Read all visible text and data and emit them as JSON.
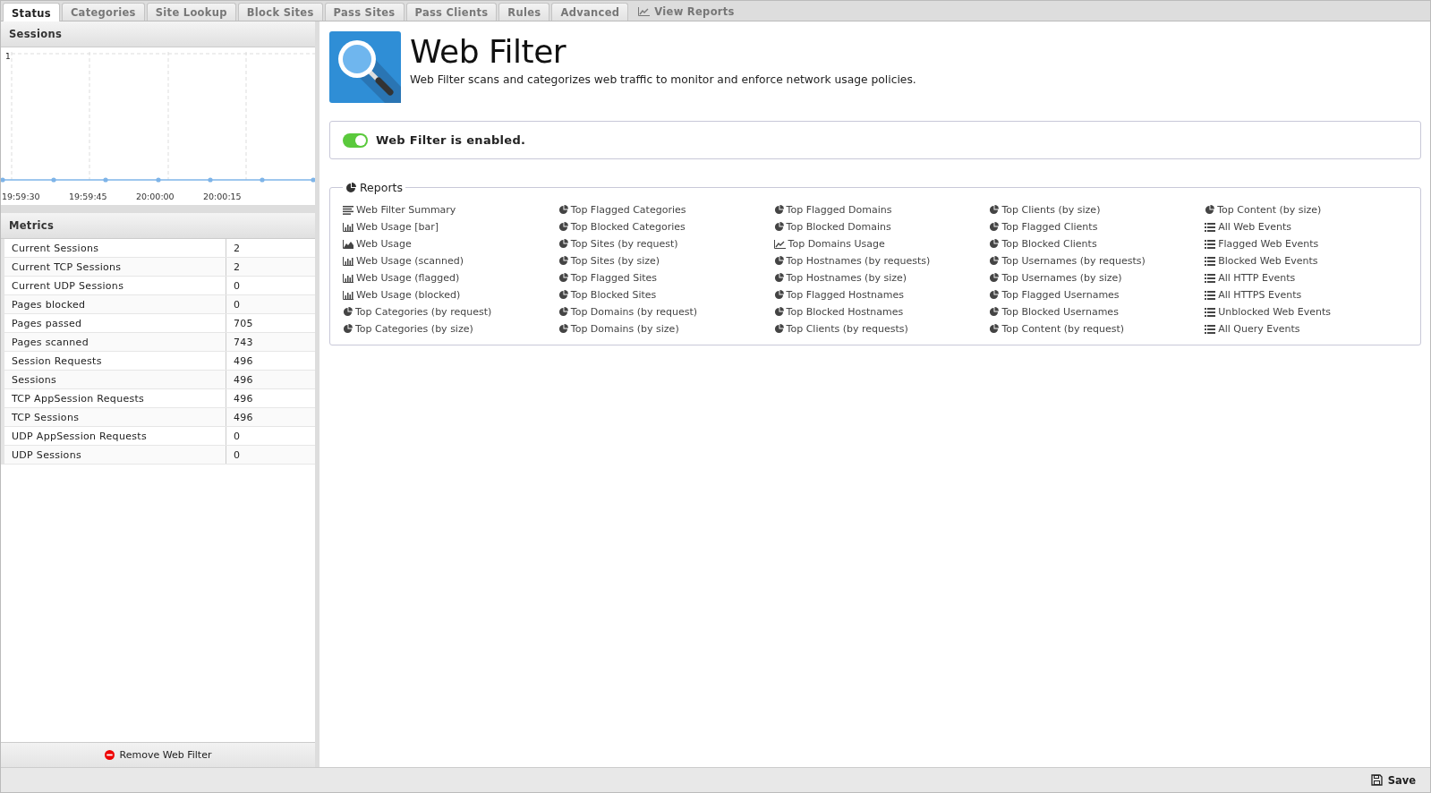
{
  "tabs": [
    {
      "label": "Status",
      "selected": true,
      "kind": "tab"
    },
    {
      "label": "Categories",
      "selected": false,
      "kind": "tab"
    },
    {
      "label": "Site Lookup",
      "selected": false,
      "kind": "tab"
    },
    {
      "label": "Block Sites",
      "selected": false,
      "kind": "tab"
    },
    {
      "label": "Pass Sites",
      "selected": false,
      "kind": "tab"
    },
    {
      "label": "Pass Clients",
      "selected": false,
      "kind": "tab"
    },
    {
      "label": "Rules",
      "selected": false,
      "kind": "tab"
    },
    {
      "label": "Advanced",
      "selected": false,
      "kind": "tab"
    },
    {
      "label": "View Reports",
      "selected": false,
      "kind": "link"
    }
  ],
  "sessions": {
    "title": "Sessions",
    "y_label": "1",
    "x_labels": [
      "19:59:30",
      "19:59:45",
      "20:00:00",
      "20:00:15"
    ]
  },
  "metrics": {
    "title": "Metrics",
    "rows": [
      {
        "name": "Current Sessions",
        "value": "2"
      },
      {
        "name": "Current TCP Sessions",
        "value": "2"
      },
      {
        "name": "Current UDP Sessions",
        "value": "0"
      },
      {
        "name": "Pages blocked",
        "value": "0"
      },
      {
        "name": "Pages passed",
        "value": "705"
      },
      {
        "name": "Pages scanned",
        "value": "743"
      },
      {
        "name": "Session Requests",
        "value": "496"
      },
      {
        "name": "Sessions",
        "value": "496"
      },
      {
        "name": "TCP AppSession Requests",
        "value": "496"
      },
      {
        "name": "TCP Sessions",
        "value": "496"
      },
      {
        "name": "UDP AppSession Requests",
        "value": "0"
      },
      {
        "name": "UDP Sessions",
        "value": "0"
      }
    ]
  },
  "remove_button": "Remove Web Filter",
  "app": {
    "title": "Web Filter",
    "description": "Web Filter scans and categorizes web traffic to monitor and enforce network usage policies."
  },
  "status": {
    "text": "Web Filter is enabled.",
    "on": true
  },
  "reports": {
    "title": "Reports",
    "columns": [
      [
        {
          "label": "Web Filter Summary",
          "kind": "text"
        },
        {
          "label": "Web Usage [bar]",
          "kind": "bar"
        },
        {
          "label": "Web Usage",
          "kind": "area"
        },
        {
          "label": "Web Usage (scanned)",
          "kind": "bar"
        },
        {
          "label": "Web Usage (flagged)",
          "kind": "bar"
        },
        {
          "label": "Web Usage (blocked)",
          "kind": "bar"
        },
        {
          "label": "Top Categories (by request)",
          "kind": "pie"
        },
        {
          "label": "Top Categories (by size)",
          "kind": "pie"
        }
      ],
      [
        {
          "label": "Top Flagged Categories",
          "kind": "pie"
        },
        {
          "label": "Top Blocked Categories",
          "kind": "pie"
        },
        {
          "label": "Top Sites (by request)",
          "kind": "pie"
        },
        {
          "label": "Top Sites (by size)",
          "kind": "pie"
        },
        {
          "label": "Top Flagged Sites",
          "kind": "pie"
        },
        {
          "label": "Top Blocked Sites",
          "kind": "pie"
        },
        {
          "label": "Top Domains (by request)",
          "kind": "pie"
        },
        {
          "label": "Top Domains (by size)",
          "kind": "pie"
        }
      ],
      [
        {
          "label": "Top Flagged Domains",
          "kind": "pie"
        },
        {
          "label": "Top Blocked Domains",
          "kind": "pie"
        },
        {
          "label": "Top Domains Usage",
          "kind": "line"
        },
        {
          "label": "Top Hostnames (by requests)",
          "kind": "pie"
        },
        {
          "label": "Top Hostnames (by size)",
          "kind": "pie"
        },
        {
          "label": "Top Flagged Hostnames",
          "kind": "pie"
        },
        {
          "label": "Top Blocked Hostnames",
          "kind": "pie"
        },
        {
          "label": "Top Clients (by requests)",
          "kind": "pie"
        }
      ],
      [
        {
          "label": "Top Clients (by size)",
          "kind": "pie"
        },
        {
          "label": "Top Flagged Clients",
          "kind": "pie"
        },
        {
          "label": "Top Blocked Clients",
          "kind": "pie"
        },
        {
          "label": "Top Usernames (by requests)",
          "kind": "pie"
        },
        {
          "label": "Top Usernames (by size)",
          "kind": "pie"
        },
        {
          "label": "Top Flagged Usernames",
          "kind": "pie"
        },
        {
          "label": "Top Blocked Usernames",
          "kind": "pie"
        },
        {
          "label": "Top Content (by request)",
          "kind": "pie"
        }
      ],
      [
        {
          "label": "Top Content (by size)",
          "kind": "pie"
        },
        {
          "label": "All Web Events",
          "kind": "events"
        },
        {
          "label": "Flagged Web Events",
          "kind": "events"
        },
        {
          "label": "Blocked Web Events",
          "kind": "events"
        },
        {
          "label": "All HTTP Events",
          "kind": "events"
        },
        {
          "label": "All HTTPS Events",
          "kind": "events"
        },
        {
          "label": "Unblocked Web Events",
          "kind": "events"
        },
        {
          "label": "All Query Events",
          "kind": "events"
        }
      ]
    ]
  },
  "save_button": "Save"
}
